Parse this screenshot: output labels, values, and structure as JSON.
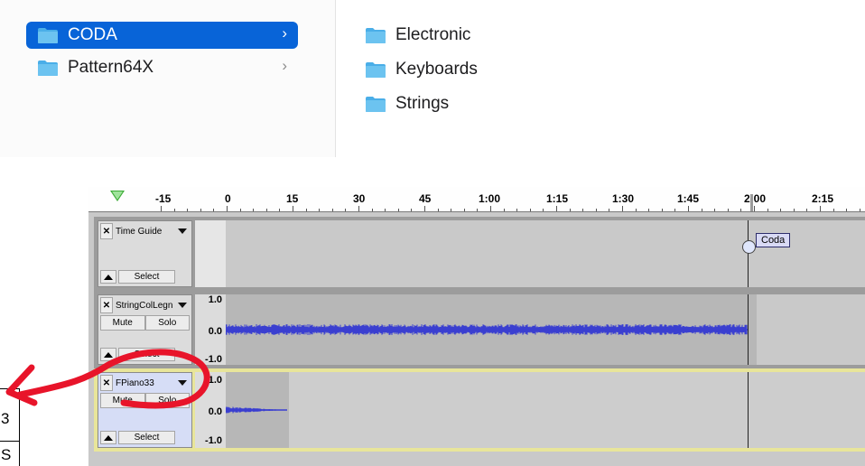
{
  "finder": {
    "column1": [
      {
        "label": "CODA",
        "selected": true,
        "chevron": "›"
      },
      {
        "label": "Pattern64X",
        "selected": false,
        "chevron": "›"
      }
    ],
    "column2": [
      {
        "label": "Electronic"
      },
      {
        "label": "Keyboards"
      },
      {
        "label": "Strings"
      }
    ],
    "folder_icon": "folder-icon",
    "colors": {
      "selection": "#0864d8",
      "folder": "#4aaee8"
    }
  },
  "audacity": {
    "ruler_labels": [
      "-15",
      "0",
      "15",
      "30",
      "45",
      "1:00",
      "1:15",
      "1:30",
      "1:45",
      "2:00",
      "2:15"
    ],
    "tracks": [
      {
        "name": "Time Guide",
        "select_label": "Select",
        "label_text": "Coda"
      },
      {
        "name": "StringColLegn",
        "mute_label": "Mute",
        "solo_label": "Solo",
        "select_label": "Select",
        "scale": [
          "1.0",
          "0.0",
          "-1.0"
        ]
      },
      {
        "name": "FPiano33",
        "mute_label": "Mute",
        "solo_label": "Solo",
        "select_label": "Select",
        "scale": [
          "1.0",
          "0.0",
          "-1.0"
        ]
      }
    ],
    "colors": {
      "waveform": "#3a3fd0",
      "active_track_border": "#e8e59a"
    }
  },
  "annotation": {
    "color": "#e8142a"
  },
  "doc_fragment": {
    "chars": [
      "3",
      "S"
    ]
  }
}
